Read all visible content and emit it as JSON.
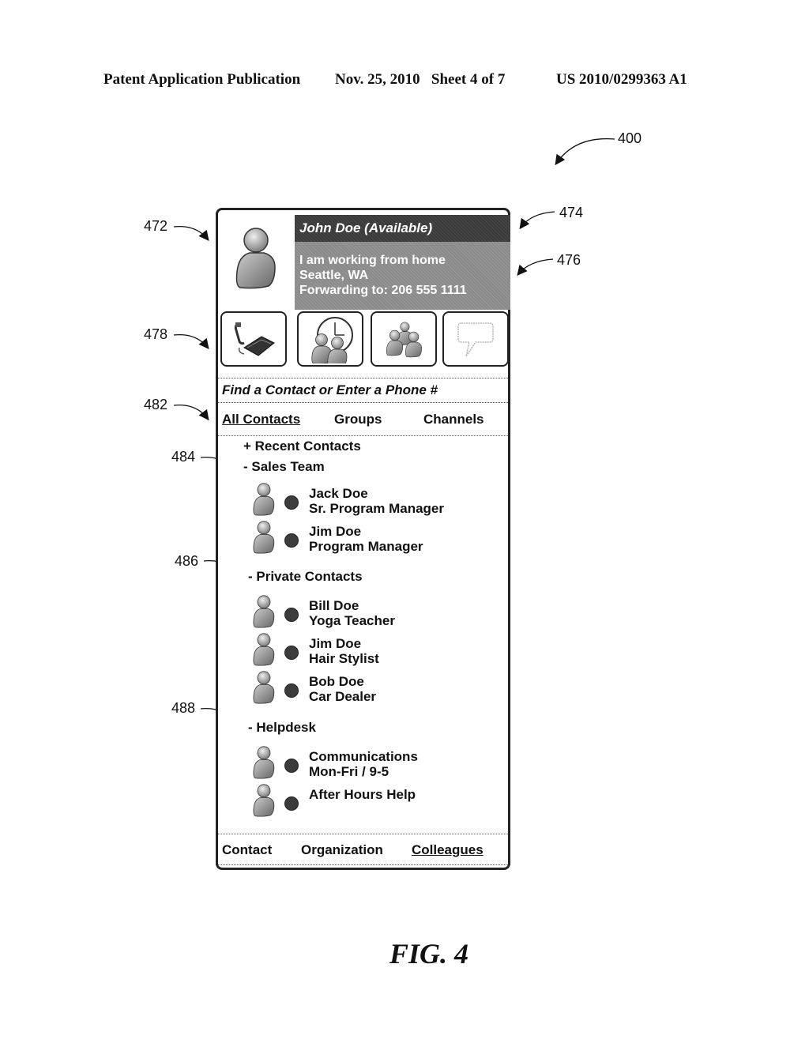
{
  "header": {
    "publication": "Patent Application Publication",
    "date_sheet": "Nov. 25, 2010   Sheet 4 of 7",
    "number": "US 2010/0299363 A1"
  },
  "refs": {
    "r400": "400",
    "r472": "472",
    "r474": "474",
    "r476": "476",
    "r478": "478",
    "r482": "482",
    "r484": "484",
    "r486": "486",
    "r488": "488"
  },
  "profile": {
    "name_status": "John Doe (Available)",
    "note": "I am working from home",
    "location": "Seattle, WA",
    "forwarding": "Forwarding to: 206 555 1111"
  },
  "actions": [
    {
      "icon": "phone-icon"
    },
    {
      "icon": "clock-meeting-icon"
    },
    {
      "icon": "group-icon"
    },
    {
      "icon": "speech-bubble-icon"
    }
  ],
  "search": {
    "placeholder": "Find a Contact or Enter a Phone #"
  },
  "tabs": [
    {
      "label": "All Contacts",
      "active": true
    },
    {
      "label": "Groups",
      "active": false
    },
    {
      "label": "Channels",
      "active": false
    }
  ],
  "groups": {
    "recent": "+ Recent Contacts",
    "sales": "- Sales Team",
    "private": "- Private Contacts",
    "helpdesk": "- Helpdesk"
  },
  "contacts": {
    "sales": [
      {
        "name": "Jack Doe",
        "detail": "Sr. Program Manager"
      },
      {
        "name": "Jim Doe",
        "detail": "Program Manager"
      }
    ],
    "private": [
      {
        "name": "Bill Doe",
        "detail": "Yoga Teacher"
      },
      {
        "name": "Jim Doe",
        "detail": "Hair Stylist"
      },
      {
        "name": "Bob Doe",
        "detail": "Car Dealer"
      }
    ],
    "helpdesk": [
      {
        "name": "Communications",
        "detail": "Mon-Fri / 9-5"
      },
      {
        "name": "After Hours Help",
        "detail": ""
      }
    ]
  },
  "bottom_tabs": [
    {
      "label": "Contact",
      "active": false
    },
    {
      "label": "Organization",
      "active": false
    },
    {
      "label": "Colleagues",
      "active": true
    }
  ],
  "figure_label": "FIG. 4"
}
